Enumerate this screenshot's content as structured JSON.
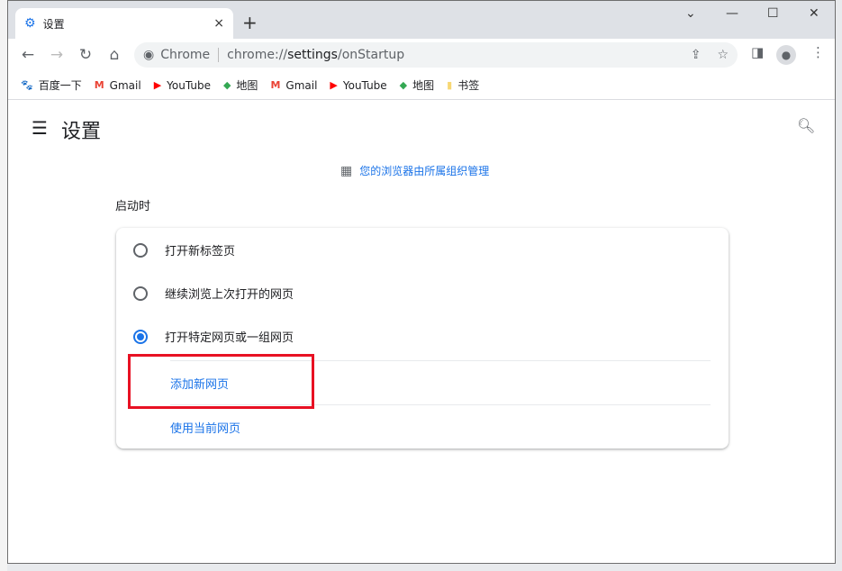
{
  "tab": {
    "title": "设置",
    "close": "×",
    "new": "+",
    "icon": "gear-icon"
  },
  "window_controls": {
    "dropdown": "⌄",
    "minimize": "—",
    "maximize": "☐",
    "close": "✕"
  },
  "omnibox": {
    "site": "Chrome",
    "url_prefix": "chrome://",
    "url_main": "settings",
    "url_suffix": "/onStartup"
  },
  "bookmarks": [
    {
      "label": "百度一下",
      "icon": "baidu-icon",
      "glyph": "🐾",
      "color": "#2932e1"
    },
    {
      "label": "Gmail",
      "icon": "gmail-icon",
      "glyph": "M",
      "color": "#ea4335"
    },
    {
      "label": "YouTube",
      "icon": "youtube-icon",
      "glyph": "▶",
      "color": "#ff0000"
    },
    {
      "label": "地图",
      "icon": "maps-icon",
      "glyph": "◆",
      "color": "#34a853"
    },
    {
      "label": "Gmail",
      "icon": "gmail-icon",
      "glyph": "M",
      "color": "#ea4335"
    },
    {
      "label": "YouTube",
      "icon": "youtube-icon",
      "glyph": "▶",
      "color": "#ff0000"
    },
    {
      "label": "地图",
      "icon": "maps-icon",
      "glyph": "◆",
      "color": "#34a853"
    },
    {
      "label": "书签",
      "icon": "folder-icon",
      "glyph": "▮",
      "color": "#f7d774"
    }
  ],
  "page": {
    "title": "设置",
    "managed": "您的浏览器由所属组织管理",
    "section": "启动时",
    "options": [
      {
        "label": "打开新标签页",
        "selected": false
      },
      {
        "label": "继续浏览上次打开的网页",
        "selected": false
      },
      {
        "label": "打开特定网页或一组网页",
        "selected": true
      }
    ],
    "add_page": "添加新网页",
    "use_current": "使用当前网页"
  },
  "colors": {
    "accent": "#1a73e8",
    "highlight": "#e81123"
  }
}
